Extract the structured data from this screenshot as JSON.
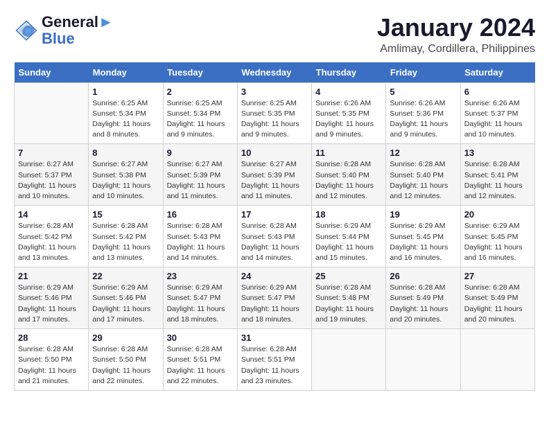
{
  "header": {
    "logo_line1": "General",
    "logo_line2": "Blue",
    "month_title": "January 2024",
    "location": "Amlimay, Cordillera, Philippines"
  },
  "days_of_week": [
    "Sunday",
    "Monday",
    "Tuesday",
    "Wednesday",
    "Thursday",
    "Friday",
    "Saturday"
  ],
  "weeks": [
    [
      {
        "day": "",
        "info": ""
      },
      {
        "day": "1",
        "info": "Sunrise: 6:25 AM\nSunset: 5:34 PM\nDaylight: 11 hours\nand 8 minutes."
      },
      {
        "day": "2",
        "info": "Sunrise: 6:25 AM\nSunset: 5:34 PM\nDaylight: 11 hours\nand 9 minutes."
      },
      {
        "day": "3",
        "info": "Sunrise: 6:25 AM\nSunset: 5:35 PM\nDaylight: 11 hours\nand 9 minutes."
      },
      {
        "day": "4",
        "info": "Sunrise: 6:26 AM\nSunset: 5:35 PM\nDaylight: 11 hours\nand 9 minutes."
      },
      {
        "day": "5",
        "info": "Sunrise: 6:26 AM\nSunset: 5:36 PM\nDaylight: 11 hours\nand 9 minutes."
      },
      {
        "day": "6",
        "info": "Sunrise: 6:26 AM\nSunset: 5:37 PM\nDaylight: 11 hours\nand 10 minutes."
      }
    ],
    [
      {
        "day": "7",
        "info": "Sunrise: 6:27 AM\nSunset: 5:37 PM\nDaylight: 11 hours\nand 10 minutes."
      },
      {
        "day": "8",
        "info": "Sunrise: 6:27 AM\nSunset: 5:38 PM\nDaylight: 11 hours\nand 10 minutes."
      },
      {
        "day": "9",
        "info": "Sunrise: 6:27 AM\nSunset: 5:39 PM\nDaylight: 11 hours\nand 11 minutes."
      },
      {
        "day": "10",
        "info": "Sunrise: 6:27 AM\nSunset: 5:39 PM\nDaylight: 11 hours\nand 11 minutes."
      },
      {
        "day": "11",
        "info": "Sunrise: 6:28 AM\nSunset: 5:40 PM\nDaylight: 11 hours\nand 12 minutes."
      },
      {
        "day": "12",
        "info": "Sunrise: 6:28 AM\nSunset: 5:40 PM\nDaylight: 11 hours\nand 12 minutes."
      },
      {
        "day": "13",
        "info": "Sunrise: 6:28 AM\nSunset: 5:41 PM\nDaylight: 11 hours\nand 12 minutes."
      }
    ],
    [
      {
        "day": "14",
        "info": "Sunrise: 6:28 AM\nSunset: 5:42 PM\nDaylight: 11 hours\nand 13 minutes."
      },
      {
        "day": "15",
        "info": "Sunrise: 6:28 AM\nSunset: 5:42 PM\nDaylight: 11 hours\nand 13 minutes."
      },
      {
        "day": "16",
        "info": "Sunrise: 6:28 AM\nSunset: 5:43 PM\nDaylight: 11 hours\nand 14 minutes."
      },
      {
        "day": "17",
        "info": "Sunrise: 6:28 AM\nSunset: 5:43 PM\nDaylight: 11 hours\nand 14 minutes."
      },
      {
        "day": "18",
        "info": "Sunrise: 6:29 AM\nSunset: 5:44 PM\nDaylight: 11 hours\nand 15 minutes."
      },
      {
        "day": "19",
        "info": "Sunrise: 6:29 AM\nSunset: 5:45 PM\nDaylight: 11 hours\nand 16 minutes."
      },
      {
        "day": "20",
        "info": "Sunrise: 6:29 AM\nSunset: 5:45 PM\nDaylight: 11 hours\nand 16 minutes."
      }
    ],
    [
      {
        "day": "21",
        "info": "Sunrise: 6:29 AM\nSunset: 5:46 PM\nDaylight: 11 hours\nand 17 minutes."
      },
      {
        "day": "22",
        "info": "Sunrise: 6:29 AM\nSunset: 5:46 PM\nDaylight: 11 hours\nand 17 minutes."
      },
      {
        "day": "23",
        "info": "Sunrise: 6:29 AM\nSunset: 5:47 PM\nDaylight: 11 hours\nand 18 minutes."
      },
      {
        "day": "24",
        "info": "Sunrise: 6:29 AM\nSunset: 5:47 PM\nDaylight: 11 hours\nand 18 minutes."
      },
      {
        "day": "25",
        "info": "Sunrise: 6:28 AM\nSunset: 5:48 PM\nDaylight: 11 hours\nand 19 minutes."
      },
      {
        "day": "26",
        "info": "Sunrise: 6:28 AM\nSunset: 5:49 PM\nDaylight: 11 hours\nand 20 minutes."
      },
      {
        "day": "27",
        "info": "Sunrise: 6:28 AM\nSunset: 5:49 PM\nDaylight: 11 hours\nand 20 minutes."
      }
    ],
    [
      {
        "day": "28",
        "info": "Sunrise: 6:28 AM\nSunset: 5:50 PM\nDaylight: 11 hours\nand 21 minutes."
      },
      {
        "day": "29",
        "info": "Sunrise: 6:28 AM\nSunset: 5:50 PM\nDaylight: 11 hours\nand 22 minutes."
      },
      {
        "day": "30",
        "info": "Sunrise: 6:28 AM\nSunset: 5:51 PM\nDaylight: 11 hours\nand 22 minutes."
      },
      {
        "day": "31",
        "info": "Sunrise: 6:28 AM\nSunset: 5:51 PM\nDaylight: 11 hours\nand 23 minutes."
      },
      {
        "day": "",
        "info": ""
      },
      {
        "day": "",
        "info": ""
      },
      {
        "day": "",
        "info": ""
      }
    ]
  ]
}
